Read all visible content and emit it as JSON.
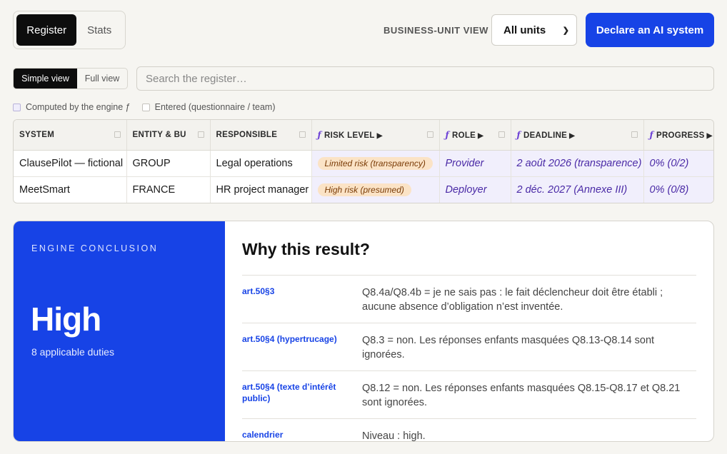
{
  "top_tabs": {
    "register": "Register",
    "stats": "Stats"
  },
  "business_unit": {
    "label": "BUSINESS-UNIT VIEW",
    "selected": "All units"
  },
  "declare_button": "Declare an AI system",
  "view_toggle": {
    "simple": "Simple view",
    "full": "Full view"
  },
  "search": {
    "placeholder": "Search the register…",
    "value": ""
  },
  "legend": {
    "computed": "Computed by the engine ƒ",
    "entered": "Entered (questionnaire / team)"
  },
  "table": {
    "headers": {
      "system": "SYSTEM",
      "entity": "ENTITY & BU",
      "responsible": "RESPONSIBLE",
      "risk": "RISK LEVEL",
      "role": "ROLE",
      "deadline": "DEADLINE",
      "progress": "PROGRESS"
    },
    "fx_glyph": "ƒ",
    "sort_arrow": "▶",
    "rows": [
      {
        "system": "ClausePilot — fictional",
        "entity": "GROUP",
        "responsible": "Legal operations",
        "risk": "Limited risk (transparency)",
        "role": "Provider",
        "deadline": "2 août 2026 (transparence)",
        "progress": "0% (0/2)"
      },
      {
        "system": "MeetSmart",
        "entity": "FRANCE",
        "responsible": "HR project manager",
        "risk": "High risk (presumed)",
        "role": "Deployer",
        "deadline": "2 déc. 2027 (Annexe III)",
        "progress": "0% (0/8)"
      }
    ]
  },
  "conclusion": {
    "kicker": "ENGINE CONCLUSION",
    "level": "High",
    "duties": "8 applicable duties",
    "why_title": "Why this result?",
    "reasons": [
      {
        "ref": "art.50§3",
        "text": "Q8.4a/Q8.4b = je ne sais pas : le fait déclencheur doit être établi ; aucune absence d’obligation n’est inventée."
      },
      {
        "ref": "art.50§4 (hypertrucage)",
        "text": "Q8.3 = non. Les réponses enfants masquées Q8.13-Q8.14 sont ignorées."
      },
      {
        "ref": "art.50§4 (texte d’intérêt public)",
        "text": "Q8.12 = non. Les réponses enfants masquées Q8.15-Q8.17 et Q8.21 sont ignorées."
      },
      {
        "ref": "calendrier",
        "text": "Niveau : high."
      }
    ]
  },
  "colors": {
    "accent": "#1743e6",
    "computed_bg": "#f1effc",
    "computed_text": "#4a2aa6",
    "pill_bg": "#fbe3c6"
  }
}
